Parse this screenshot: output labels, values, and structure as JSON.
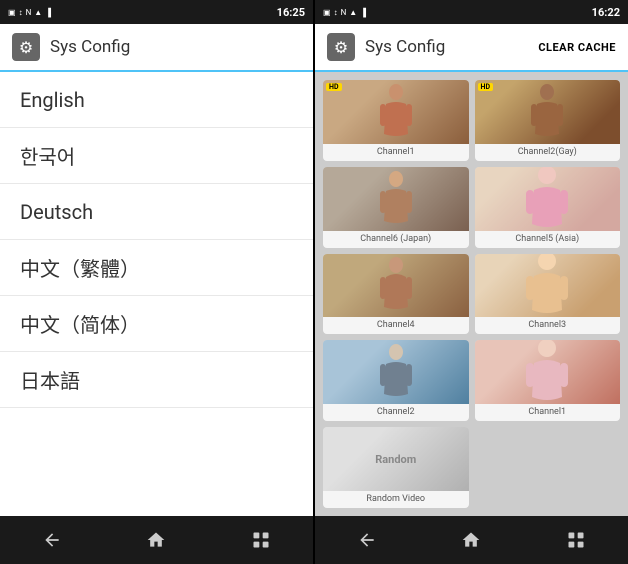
{
  "phone1": {
    "status_bar": {
      "time": "16:25",
      "icons": [
        "sim",
        "data",
        "wifi",
        "signal",
        "battery"
      ]
    },
    "app_bar": {
      "title": "Sys Config",
      "icon": "⚙"
    },
    "languages": [
      {
        "label": "English"
      },
      {
        "label": "한국어"
      },
      {
        "label": "Deutsch"
      },
      {
        "label": "中文（繁體）"
      },
      {
        "label": "中文（简体）"
      },
      {
        "label": "日本語"
      }
    ],
    "nav": {
      "back": "←",
      "home": "⌂",
      "recents": "▣"
    }
  },
  "phone2": {
    "status_bar": {
      "time": "16:22",
      "icons": [
        "sim",
        "data",
        "wifi",
        "signal",
        "battery"
      ]
    },
    "app_bar": {
      "title": "Sys Config",
      "icon": "⚙",
      "action": "CLEAR CACHE"
    },
    "channels": [
      {
        "id": "ch1",
        "label": "Channel1",
        "hd": true,
        "thumb_class": "thumb-1"
      },
      {
        "id": "ch2g",
        "label": "Channel2(Gay)",
        "hd": true,
        "thumb_class": "thumb-2"
      },
      {
        "id": "ch6j",
        "label": "Channel6 (Japan)",
        "hd": false,
        "thumb_class": "thumb-3"
      },
      {
        "id": "ch5a",
        "label": "Channel5 (Asia)",
        "hd": false,
        "thumb_class": "thumb-4"
      },
      {
        "id": "ch4",
        "label": "Channel4",
        "hd": false,
        "thumb_class": "thumb-5"
      },
      {
        "id": "ch3",
        "label": "Channel3",
        "hd": false,
        "thumb_class": "thumb-6"
      },
      {
        "id": "ch2",
        "label": "Channel2",
        "hd": false,
        "thumb_class": "thumb-7"
      },
      {
        "id": "ch1b",
        "label": "Channel1",
        "hd": false,
        "thumb_class": "thumb-8"
      },
      {
        "id": "rand",
        "label": "Random Video",
        "hd": false,
        "thumb_class": "thumb-random"
      }
    ],
    "nav": {
      "back": "←",
      "home": "⌂",
      "recents": "▣"
    }
  }
}
